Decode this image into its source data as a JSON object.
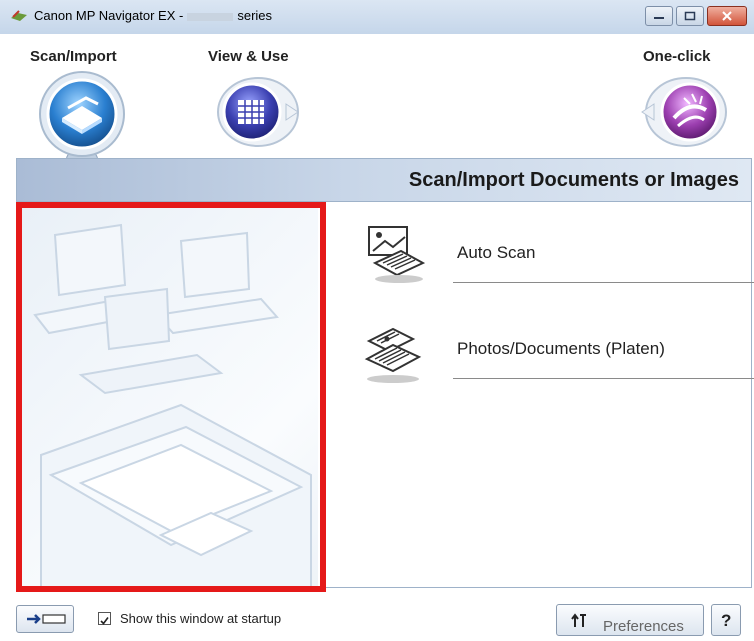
{
  "window": {
    "title_prefix": "Canon MP Navigator EX -",
    "title_suffix": "series"
  },
  "modes": [
    {
      "label": "Scan/Import",
      "icon": "scanner-icon",
      "selected": true
    },
    {
      "label": "View & Use",
      "icon": "grid-view-icon",
      "selected": false
    },
    {
      "label": "One-click",
      "icon": "one-click-icon",
      "selected": false
    }
  ],
  "panel": {
    "title": "Scan/Import Documents or Images"
  },
  "scan_options": [
    {
      "label": "Auto Scan",
      "icon": "auto-scan-icon"
    },
    {
      "label": "Photos/Documents (Platen)",
      "icon": "platen-scan-icon"
    }
  ],
  "footer": {
    "show_at_startup_label": "Show this window at startup",
    "show_at_startup_checked": true,
    "preferences_label": "Preferences",
    "help_label": "?"
  },
  "colors": {
    "highlight": "#e51919",
    "header_gradient_start": "#aabcd6",
    "accent_blue": "#2a7fd0",
    "accent_purple": "#9c3fb0"
  }
}
